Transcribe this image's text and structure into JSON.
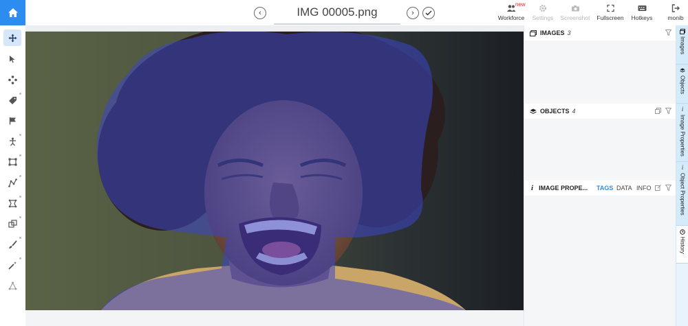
{
  "header": {
    "title": "IMG 00005.png",
    "tools": [
      {
        "label": "Workforce",
        "icon": "users-icon",
        "badge": "new"
      },
      {
        "label": "Settings",
        "icon": "gear-icon"
      },
      {
        "label": "Screenshot",
        "icon": "camera-icon"
      },
      {
        "label": "Fullscreen",
        "icon": "fullscreen-icon"
      },
      {
        "label": "Hotkeys",
        "icon": "keyboard-icon"
      },
      {
        "label": "monib",
        "icon": "logout-icon"
      }
    ]
  },
  "panels": {
    "images": {
      "title": "IMAGES",
      "count": "3"
    },
    "objects": {
      "title": "OBJECTS",
      "count": "4"
    },
    "props": {
      "title": "IMAGE PROPE...",
      "tab_tags": "TAGS",
      "tab_data": "DATA",
      "tab_info": "INFO"
    }
  },
  "side_tabs": [
    "Images",
    "Objects",
    "Image Properties",
    "Object Properties",
    "History"
  ],
  "colors": {
    "accent": "#2d8cf0",
    "overlay": "#3d46c8",
    "active_tool_bg": "#d7e7fb"
  }
}
